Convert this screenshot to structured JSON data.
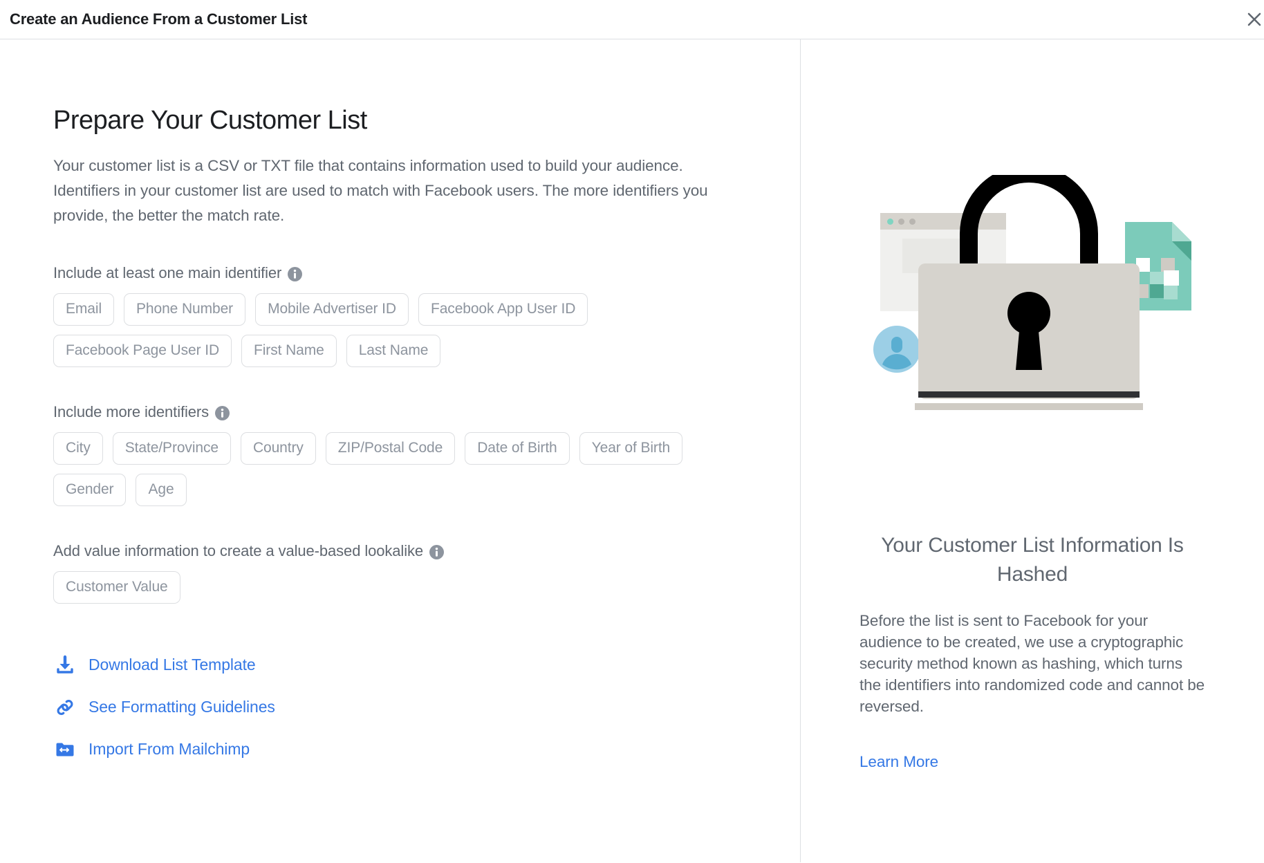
{
  "dialog": {
    "title": "Create an Audience From a Customer List",
    "close_icon": "close-icon"
  },
  "left": {
    "heading": "Prepare Your Customer List",
    "description": "Your customer list is a CSV or TXT file that contains information used to build your audience. Identifiers in your customer list are used to match with Facebook users. The more identifiers you provide, the better the match rate.",
    "sections": [
      {
        "label": "Include at least one main identifier",
        "info_icon": "info-icon",
        "chips": [
          "Email",
          "Phone Number",
          "Mobile Advertiser ID",
          "Facebook App User ID",
          "Facebook Page User ID",
          "First Name",
          "Last Name"
        ]
      },
      {
        "label": "Include more identifiers",
        "info_icon": "info-icon",
        "chips": [
          "City",
          "State/Province",
          "Country",
          "ZIP/Postal Code",
          "Date of Birth",
          "Year of Birth",
          "Gender",
          "Age"
        ]
      },
      {
        "label": "Add value information to create a value-based lookalike",
        "info_icon": "info-icon",
        "chips": [
          "Customer Value"
        ]
      }
    ],
    "links": [
      {
        "label": "Download List Template",
        "icon": "download-icon"
      },
      {
        "label": "See Formatting Guidelines",
        "icon": "link-chain-icon"
      },
      {
        "label": "Import From Mailchimp",
        "icon": "folder-import-icon"
      }
    ]
  },
  "right": {
    "illustration_name": "padlock-privacy-illustration",
    "heading": "Your Customer List Information Is Hashed",
    "body": "Before the list is sent to Facebook for your audience to be created, we use a cryptographic security method known as hashing, which turns the identifiers into randomized code and cannot be reversed.",
    "learn_more": "Learn More"
  },
  "colors": {
    "link_blue": "#3578e5",
    "text_gray": "#606770",
    "chip_text": "#8d949e",
    "chip_border": "#dcdee1",
    "title_black": "#1c1e21",
    "divider": "#dddfe2",
    "illustration_teal": "#7ccbba",
    "illustration_teal_dark": "#4fa892",
    "illustration_teal_light": "#a8dcd0",
    "illustration_blue": "#9ccfe6",
    "illustration_blue_dark": "#5aaed1",
    "illustration_lock_body": "#d6d3cd",
    "illustration_window_bar": "#d6d3cd"
  }
}
